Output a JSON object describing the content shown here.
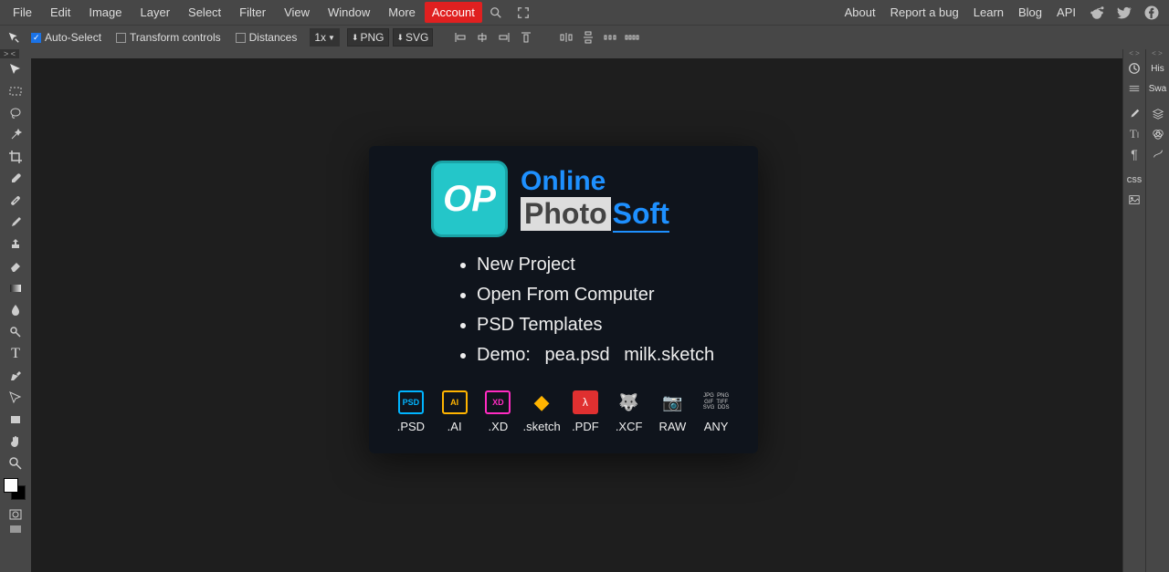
{
  "menu": {
    "items": [
      "File",
      "Edit",
      "Image",
      "Layer",
      "Select",
      "Filter",
      "View",
      "Window",
      "More",
      "Account"
    ],
    "accountIndex": 9,
    "right": [
      "About",
      "Report a bug",
      "Learn",
      "Blog",
      "API"
    ]
  },
  "options": {
    "autoSelect": {
      "label": "Auto-Select",
      "checked": true
    },
    "transform": {
      "label": "Transform controls",
      "checked": false
    },
    "distances": {
      "label": "Distances",
      "checked": false
    },
    "zoom": "1x",
    "png": "PNG",
    "svg": "SVG"
  },
  "tabstrip": {
    "dragHint": ">  <"
  },
  "welcome": {
    "brand": {
      "badge": "OP",
      "line1": "Online",
      "line2a": "Photo",
      "line2b": "Soft"
    },
    "actions": [
      "New Project",
      "Open From Computer",
      "PSD Templates"
    ],
    "demoLabel": "Demo:",
    "demoFiles": [
      "pea.psd",
      "milk.sketch"
    ],
    "formats": [
      {
        "label": ".PSD",
        "key": "psd",
        "text": "PSD"
      },
      {
        "label": ".AI",
        "key": "ai",
        "text": "AI"
      },
      {
        "label": ".XD",
        "key": "xd",
        "text": "XD"
      },
      {
        "label": ".sketch",
        "key": "sk",
        "text": "◆"
      },
      {
        "label": ".PDF",
        "key": "pdf",
        "text": "λ"
      },
      {
        "label": ".XCF",
        "key": "xcf",
        "text": "🐺"
      },
      {
        "label": "RAW",
        "key": "raw",
        "text": "📷"
      },
      {
        "label": "ANY",
        "key": "any",
        "text": "JPG  PNG\nGIF  TIFF\nSVG  DDS"
      }
    ]
  },
  "rightTabs": {
    "col1": [
      "His",
      "Swa"
    ],
    "icons2": [
      "layers",
      "fx",
      "warp"
    ]
  },
  "icons": {
    "alignGroup": [
      "align-left",
      "align-hcenter",
      "align-right",
      "align-top",
      "distribute-h",
      "distribute-v",
      "distribute-more"
    ]
  }
}
